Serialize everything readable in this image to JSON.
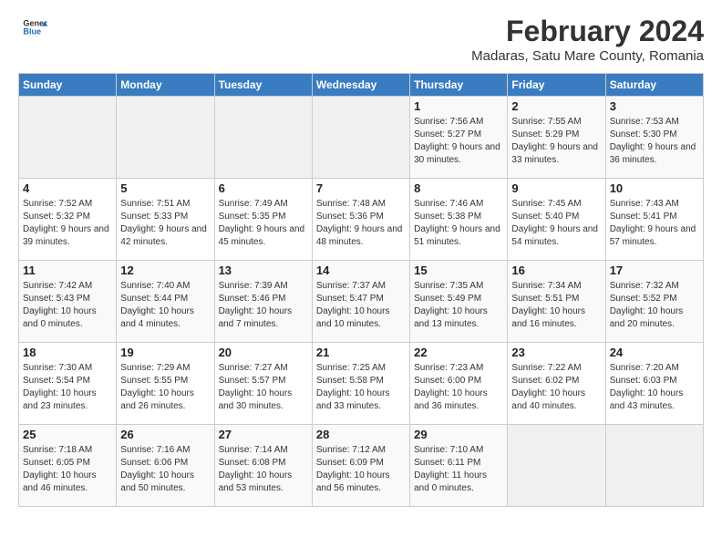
{
  "header": {
    "logo": {
      "general": "General",
      "blue": "Blue"
    },
    "title": "February 2024",
    "subtitle": "Madaras, Satu Mare County, Romania"
  },
  "days_of_week": [
    "Sunday",
    "Monday",
    "Tuesday",
    "Wednesday",
    "Thursday",
    "Friday",
    "Saturday"
  ],
  "weeks": [
    [
      {
        "day": "",
        "info": ""
      },
      {
        "day": "",
        "info": ""
      },
      {
        "day": "",
        "info": ""
      },
      {
        "day": "",
        "info": ""
      },
      {
        "day": "1",
        "info": "Sunrise: 7:56 AM\nSunset: 5:27 PM\nDaylight: 9 hours and 30 minutes."
      },
      {
        "day": "2",
        "info": "Sunrise: 7:55 AM\nSunset: 5:29 PM\nDaylight: 9 hours and 33 minutes."
      },
      {
        "day": "3",
        "info": "Sunrise: 7:53 AM\nSunset: 5:30 PM\nDaylight: 9 hours and 36 minutes."
      }
    ],
    [
      {
        "day": "4",
        "info": "Sunrise: 7:52 AM\nSunset: 5:32 PM\nDaylight: 9 hours and 39 minutes."
      },
      {
        "day": "5",
        "info": "Sunrise: 7:51 AM\nSunset: 5:33 PM\nDaylight: 9 hours and 42 minutes."
      },
      {
        "day": "6",
        "info": "Sunrise: 7:49 AM\nSunset: 5:35 PM\nDaylight: 9 hours and 45 minutes."
      },
      {
        "day": "7",
        "info": "Sunrise: 7:48 AM\nSunset: 5:36 PM\nDaylight: 9 hours and 48 minutes."
      },
      {
        "day": "8",
        "info": "Sunrise: 7:46 AM\nSunset: 5:38 PM\nDaylight: 9 hours and 51 minutes."
      },
      {
        "day": "9",
        "info": "Sunrise: 7:45 AM\nSunset: 5:40 PM\nDaylight: 9 hours and 54 minutes."
      },
      {
        "day": "10",
        "info": "Sunrise: 7:43 AM\nSunset: 5:41 PM\nDaylight: 9 hours and 57 minutes."
      }
    ],
    [
      {
        "day": "11",
        "info": "Sunrise: 7:42 AM\nSunset: 5:43 PM\nDaylight: 10 hours and 0 minutes."
      },
      {
        "day": "12",
        "info": "Sunrise: 7:40 AM\nSunset: 5:44 PM\nDaylight: 10 hours and 4 minutes."
      },
      {
        "day": "13",
        "info": "Sunrise: 7:39 AM\nSunset: 5:46 PM\nDaylight: 10 hours and 7 minutes."
      },
      {
        "day": "14",
        "info": "Sunrise: 7:37 AM\nSunset: 5:47 PM\nDaylight: 10 hours and 10 minutes."
      },
      {
        "day": "15",
        "info": "Sunrise: 7:35 AM\nSunset: 5:49 PM\nDaylight: 10 hours and 13 minutes."
      },
      {
        "day": "16",
        "info": "Sunrise: 7:34 AM\nSunset: 5:51 PM\nDaylight: 10 hours and 16 minutes."
      },
      {
        "day": "17",
        "info": "Sunrise: 7:32 AM\nSunset: 5:52 PM\nDaylight: 10 hours and 20 minutes."
      }
    ],
    [
      {
        "day": "18",
        "info": "Sunrise: 7:30 AM\nSunset: 5:54 PM\nDaylight: 10 hours and 23 minutes."
      },
      {
        "day": "19",
        "info": "Sunrise: 7:29 AM\nSunset: 5:55 PM\nDaylight: 10 hours and 26 minutes."
      },
      {
        "day": "20",
        "info": "Sunrise: 7:27 AM\nSunset: 5:57 PM\nDaylight: 10 hours and 30 minutes."
      },
      {
        "day": "21",
        "info": "Sunrise: 7:25 AM\nSunset: 5:58 PM\nDaylight: 10 hours and 33 minutes."
      },
      {
        "day": "22",
        "info": "Sunrise: 7:23 AM\nSunset: 6:00 PM\nDaylight: 10 hours and 36 minutes."
      },
      {
        "day": "23",
        "info": "Sunrise: 7:22 AM\nSunset: 6:02 PM\nDaylight: 10 hours and 40 minutes."
      },
      {
        "day": "24",
        "info": "Sunrise: 7:20 AM\nSunset: 6:03 PM\nDaylight: 10 hours and 43 minutes."
      }
    ],
    [
      {
        "day": "25",
        "info": "Sunrise: 7:18 AM\nSunset: 6:05 PM\nDaylight: 10 hours and 46 minutes."
      },
      {
        "day": "26",
        "info": "Sunrise: 7:16 AM\nSunset: 6:06 PM\nDaylight: 10 hours and 50 minutes."
      },
      {
        "day": "27",
        "info": "Sunrise: 7:14 AM\nSunset: 6:08 PM\nDaylight: 10 hours and 53 minutes."
      },
      {
        "day": "28",
        "info": "Sunrise: 7:12 AM\nSunset: 6:09 PM\nDaylight: 10 hours and 56 minutes."
      },
      {
        "day": "29",
        "info": "Sunrise: 7:10 AM\nSunset: 6:11 PM\nDaylight: 11 hours and 0 minutes."
      },
      {
        "day": "",
        "info": ""
      },
      {
        "day": "",
        "info": ""
      }
    ]
  ]
}
